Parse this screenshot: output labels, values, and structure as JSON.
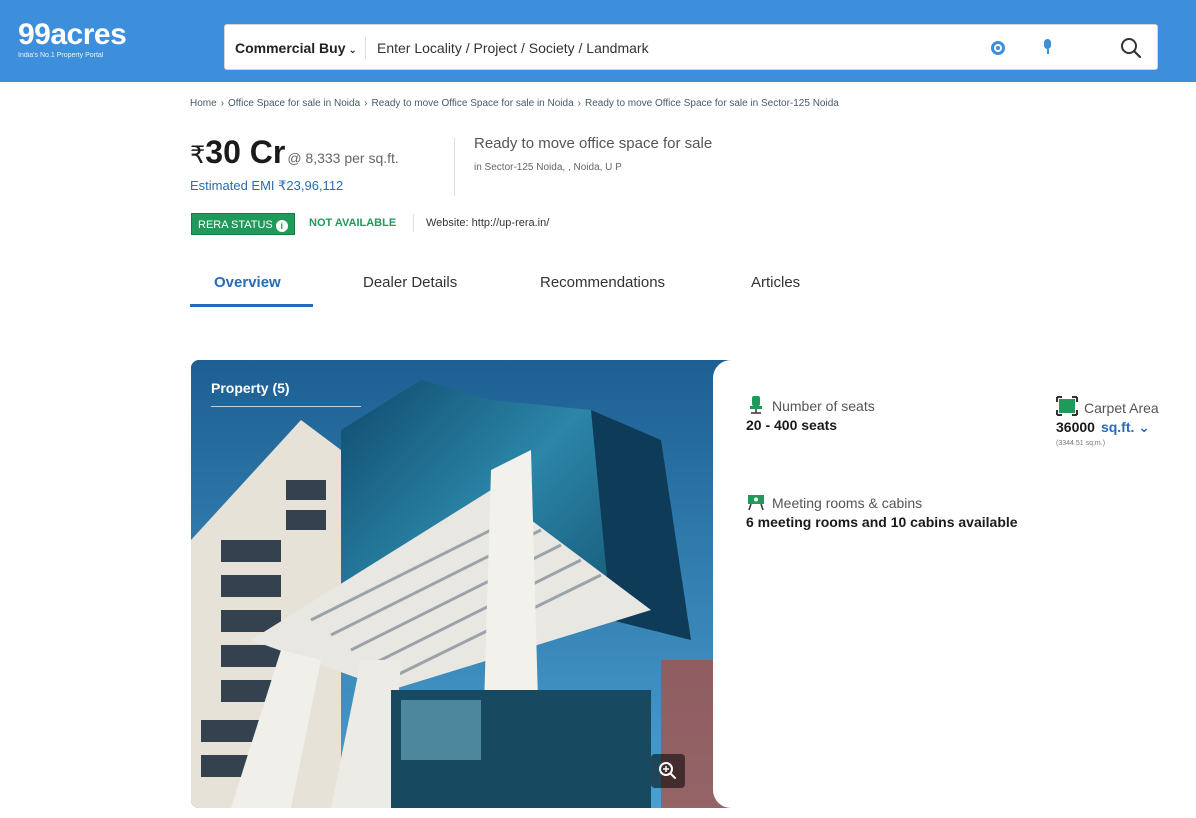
{
  "header": {
    "logo": "99acres",
    "tagline": "India's No.1 Property Portal",
    "search_type": "Commercial Buy",
    "search_placeholder": "Enter Locality / Project / Society / Landmark"
  },
  "breadcrumb": [
    "Home",
    "Office Space for sale in Noida",
    "Ready to move Office Space for sale in Noida",
    "Ready to move Office Space for sale in Sector-125 Noida"
  ],
  "listing": {
    "currency": "₹",
    "price": "30 Cr",
    "rate": "@ 8,333 per sq.ft.",
    "emi": "Estimated EMI ₹23,96,112",
    "title": "Ready to move office space for sale",
    "location": "in Sector-125 Noida, , Noida, U P"
  },
  "rera": {
    "badge": "RERA STATUS",
    "status": "NOT AVAILABLE",
    "website": "Website: http://up-rera.in/"
  },
  "tabs": [
    {
      "label": "Overview",
      "active": true
    },
    {
      "label": "Dealer Details",
      "active": false
    },
    {
      "label": "Recommendations",
      "active": false
    },
    {
      "label": "Articles",
      "active": false
    }
  ],
  "photo": {
    "label": "Property (5)"
  },
  "facts": {
    "seats_label": "Number of seats",
    "seats_value": "20 - 400 seats",
    "area_label": "Carpet Area",
    "area_value": "36000",
    "area_unit": "sq.ft.",
    "area_sub": "(3344.51 sq.m.)",
    "meeting_label": "Meeting rooms & cabins",
    "meeting_value": "6 meeting rooms and 10 cabins available"
  },
  "colors": {
    "brand_blue": "#3d8fdc",
    "link_blue": "#2a6bb5",
    "rera_green": "#1f9a5a"
  }
}
